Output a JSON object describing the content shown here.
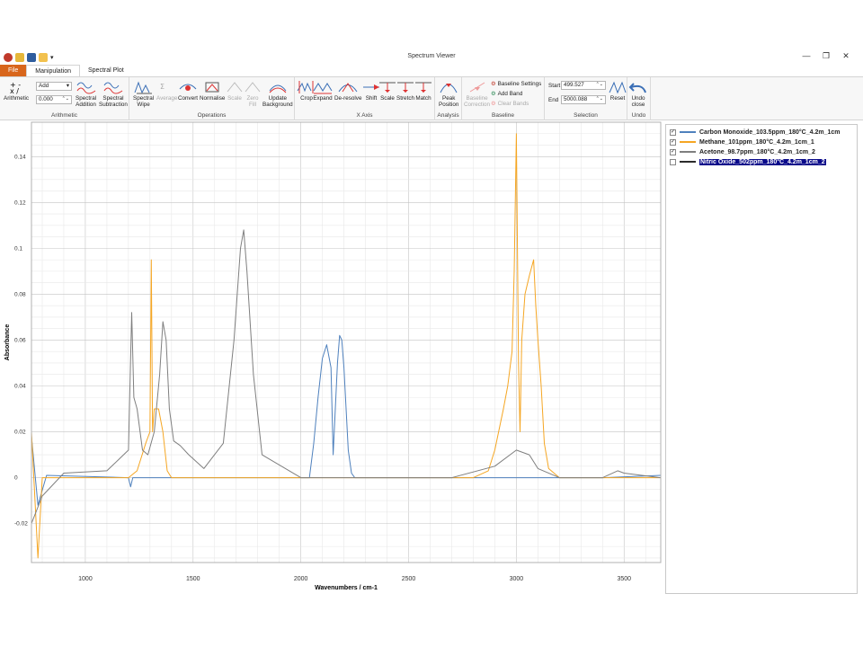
{
  "window": {
    "title": "Spectrum Viewer",
    "controls": [
      "—",
      "❐",
      "✕"
    ]
  },
  "tabs": [
    {
      "label": "File"
    },
    {
      "label": "Manipulation"
    },
    {
      "label": "Spectral Plot"
    }
  ],
  "ribbon": {
    "arithmetic": {
      "group_label": "Arithmetic",
      "button_label": "Arithmetic",
      "operation_value": "Add",
      "operand_value": "0.000",
      "addition_label": "Spectral\nAddition",
      "subtraction_label": "Spectral\nSubtraction"
    },
    "operations": {
      "group_label": "Operations",
      "wipe_label": "Spectral\nWipe",
      "average_label": "Average",
      "convert_label": "Convert",
      "normalise_label": "Normalise",
      "scale_label": "Scale",
      "zero_fill_label": "Zero\nFill",
      "update_background_label": "Update\nBackground"
    },
    "xaxis": {
      "group_label": "X Axis",
      "crop_label": "Crop",
      "expand_label": "Expand",
      "deresolve_label": "De-resolve",
      "shift_label": "Shift",
      "scale_label": "Scale",
      "stretch_label": "Stretch",
      "match_label": "Match"
    },
    "analysis": {
      "group_label": "Analysis",
      "peak_label": "Peak\nPosition"
    },
    "baseline": {
      "group_label": "Baseline",
      "correction_label": "Baseline\nCorrection",
      "settings_label": "Baseline Settings",
      "add_band_label": "Add Band",
      "clear_bands_label": "Clear Bands"
    },
    "selection": {
      "group_label": "Selection",
      "start_label": "Start",
      "start_value": "499.527",
      "end_label": "End",
      "end_value": "5000.088",
      "reset_label": "Reset"
    },
    "undo": {
      "group_label": "Undo",
      "undo_label": "Undo\nclose"
    }
  },
  "legend": [
    {
      "label": "Carbon Monoxide_103.5ppm_180°C_4.2m_1cm",
      "checked": true,
      "color": "#4f81bd"
    },
    {
      "label": "Methane_101ppm_180°C_4.2m_1cm_1",
      "checked": true,
      "color": "#f5a623"
    },
    {
      "label": "Acetone_98.7ppm_180°C_4.2m_1cm_2",
      "checked": true,
      "color": "#7f7f7f"
    },
    {
      "label": "Nitric Oxide_502ppm_180°C_4.2m_1cm_2",
      "checked": false,
      "color": "#2b2b2b",
      "selected": true
    }
  ],
  "chart_data": {
    "type": "line",
    "xlabel": "Wavenumbers / cm-1",
    "ylabel": "Absorbance",
    "xlim": [
      750,
      3670
    ],
    "ylim": [
      -0.037,
      0.155
    ],
    "xticks": [
      1000,
      1500,
      2000,
      2500,
      3000,
      3500
    ],
    "yticks": [
      -0.02,
      0,
      0.02,
      0.04,
      0.06,
      0.08,
      0.1,
      0.12,
      0.14
    ],
    "ytick_labels": [
      "-0.02",
      "0",
      "0.02",
      "0.04",
      "0.06",
      "0.08",
      "0.1",
      "0.12",
      "0.14"
    ],
    "grid": true,
    "series": [
      {
        "name": "Carbon Monoxide_103.5ppm_180°C_4.2m_1cm",
        "color": "#4f81bd",
        "x": [
          750,
          780,
          820,
          1200,
          1210,
          1220,
          2040,
          2060,
          2080,
          2100,
          2120,
          2140,
          2150,
          2160,
          2170,
          2180,
          2190,
          2200,
          2210,
          2220,
          2235,
          2250,
          3000,
          3400,
          3670
        ],
        "y": [
          0.018,
          -0.012,
          0.001,
          0.0,
          -0.004,
          0.0,
          0.0,
          0.015,
          0.035,
          0.052,
          0.058,
          0.048,
          0.01,
          0.03,
          0.05,
          0.062,
          0.06,
          0.048,
          0.03,
          0.012,
          0.002,
          0.0,
          0.0,
          0.0,
          0.001
        ]
      },
      {
        "name": "Methane_101ppm_180°C_4.2m_1cm_1",
        "color": "#f5a623",
        "x": [
          750,
          780,
          800,
          1200,
          1240,
          1280,
          1300,
          1306,
          1312,
          1320,
          1340,
          1360,
          1380,
          1400,
          2800,
          2870,
          2900,
          2940,
          2960,
          2980,
          2990,
          3000,
          3010,
          3017,
          3025,
          3040,
          3060,
          3080,
          3090,
          3100,
          3115,
          3130,
          3150,
          3200,
          3670
        ],
        "y": [
          0.02,
          -0.035,
          0.0,
          0.0,
          0.003,
          0.015,
          0.02,
          0.095,
          0.02,
          0.03,
          0.03,
          0.02,
          0.003,
          0.0,
          0.0,
          0.003,
          0.012,
          0.03,
          0.04,
          0.055,
          0.09,
          0.15,
          0.05,
          0.02,
          0.06,
          0.08,
          0.088,
          0.095,
          0.075,
          0.06,
          0.04,
          0.015,
          0.004,
          0.0,
          0.0
        ]
      },
      {
        "name": "Acetone_98.7ppm_180°C_4.2m_1cm_2",
        "color": "#7f7f7f",
        "x": [
          750,
          800,
          900,
          1100,
          1200,
          1215,
          1225,
          1240,
          1265,
          1290,
          1320,
          1345,
          1360,
          1375,
          1390,
          1410,
          1440,
          1480,
          1550,
          1640,
          1690,
          1720,
          1735,
          1750,
          1780,
          1820,
          2000,
          2700,
          2900,
          3000,
          3060,
          3100,
          3200,
          3400,
          3470,
          3500,
          3670
        ],
        "y": [
          -0.02,
          -0.008,
          0.002,
          0.003,
          0.012,
          0.072,
          0.035,
          0.03,
          0.012,
          0.01,
          0.02,
          0.045,
          0.068,
          0.06,
          0.03,
          0.016,
          0.014,
          0.01,
          0.004,
          0.015,
          0.06,
          0.1,
          0.108,
          0.09,
          0.045,
          0.01,
          0.0,
          0.0,
          0.005,
          0.012,
          0.01,
          0.004,
          0.0,
          0.0,
          0.003,
          0.002,
          0.0
        ]
      }
    ]
  }
}
